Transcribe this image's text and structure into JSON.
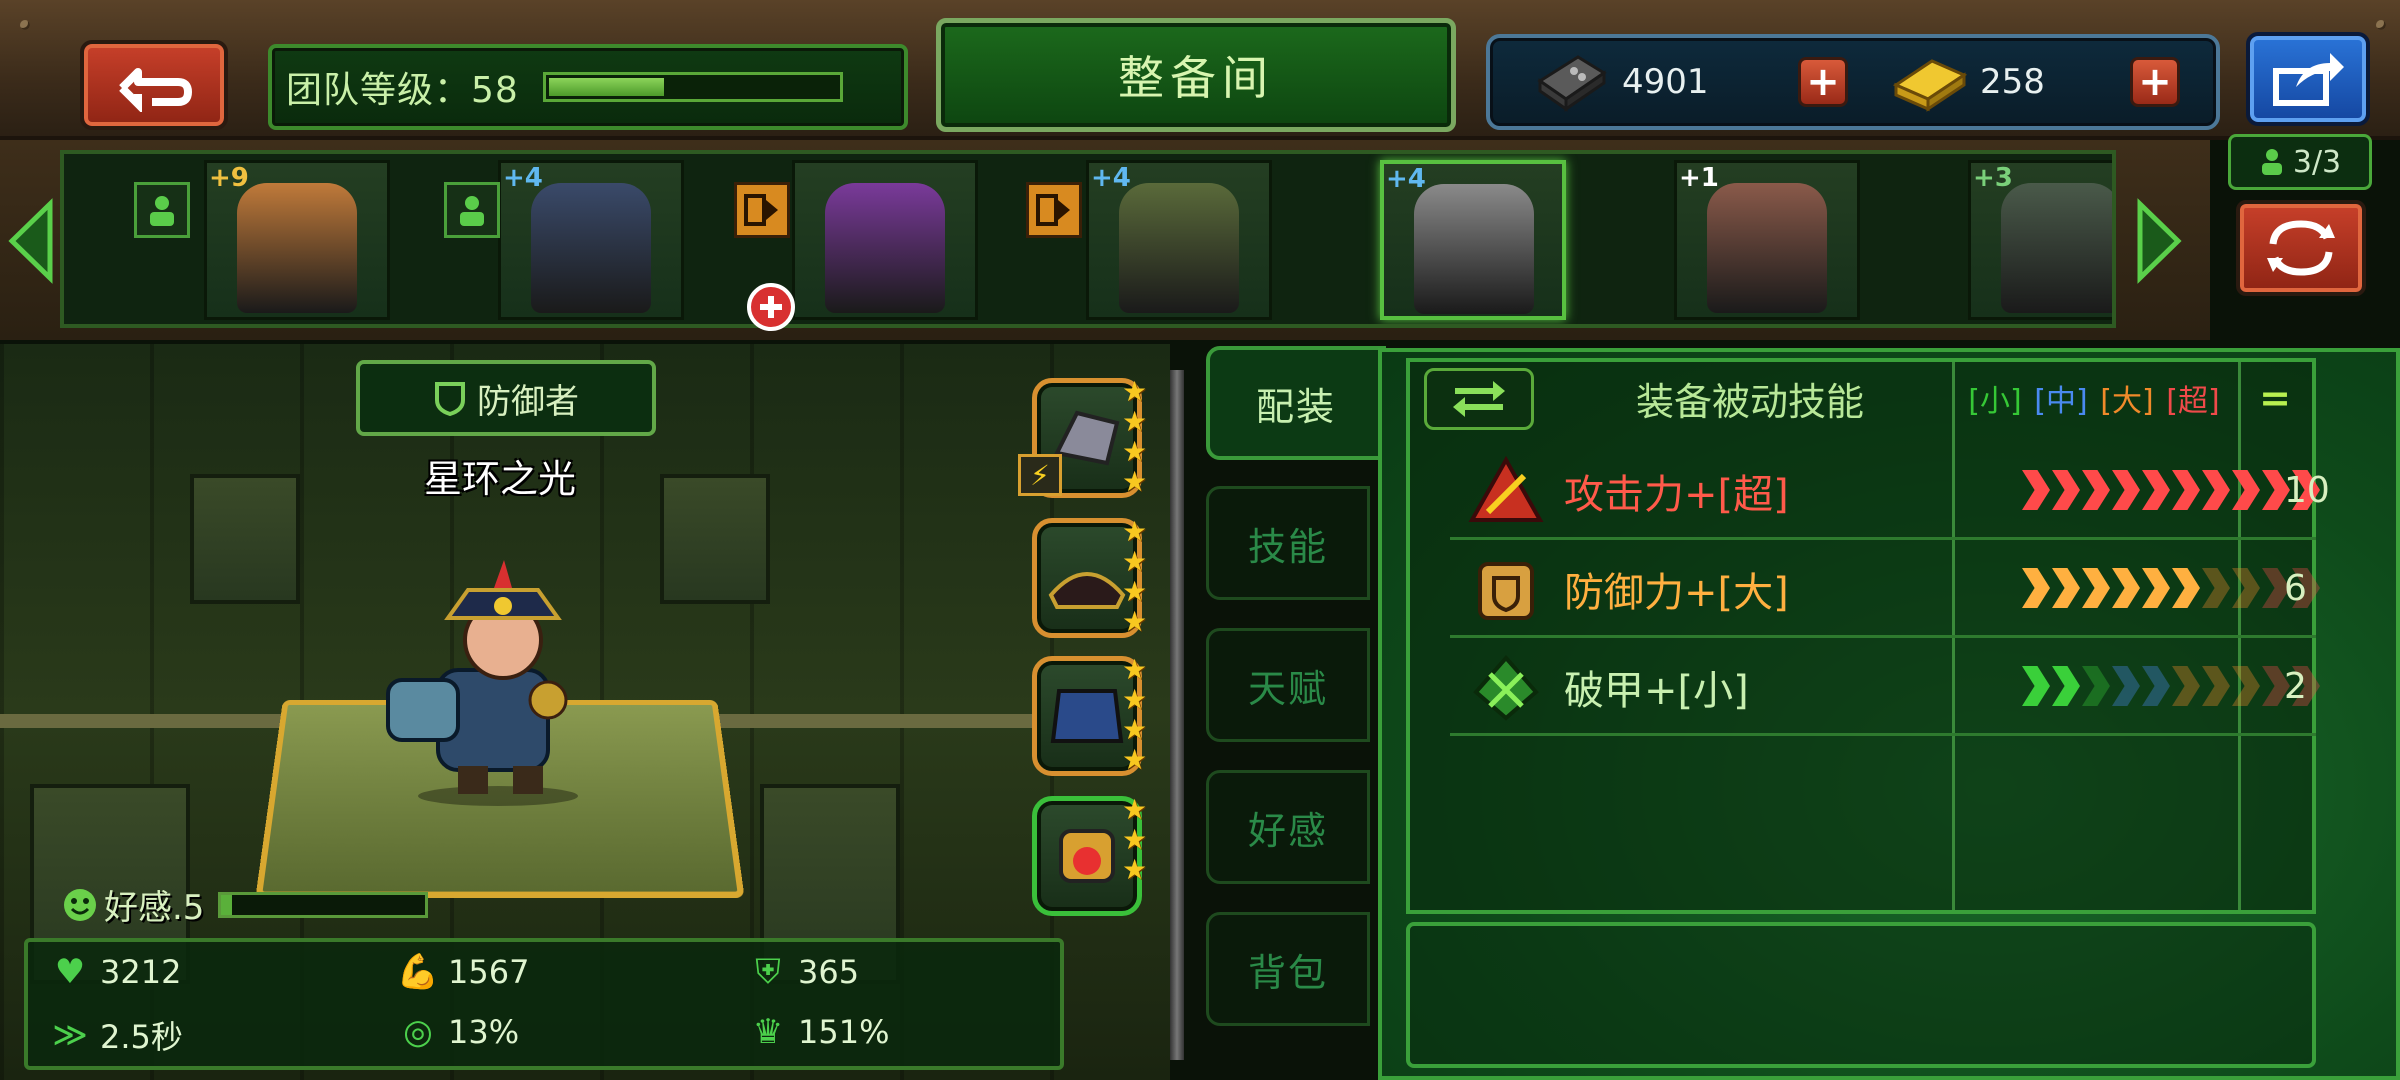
{
  "header": {
    "team_level_label": "团队等级：58",
    "team_level_progress": 0.4,
    "title": "整备间",
    "currencies": [
      {
        "name": "tech-parts",
        "value": "4901"
      },
      {
        "name": "gold-bars",
        "value": "258"
      }
    ]
  },
  "roster": {
    "count": "3/3",
    "heroes": [
      {
        "plus": "+9",
        "color": "#f0c040",
        "art": "#c07a3a"
      },
      {
        "plus": "+4",
        "color": "#60b8f0",
        "art": "#3a4a6a"
      },
      {
        "plus": "",
        "color": "#ffffff",
        "art": "#7a3a9a"
      },
      {
        "plus": "+4",
        "color": "#60b8f0",
        "art": "#5a6a3a"
      },
      {
        "plus": "+4",
        "color": "#60b8f0",
        "art": "#8a8a8a"
      },
      {
        "plus": "+1",
        "color": "#ffffff",
        "art": "#8a5a4a"
      },
      {
        "plus": "+3",
        "color": "#7ad07a",
        "art": "#4a5a4a"
      }
    ]
  },
  "hero": {
    "class_label": "防御者",
    "name": "星环之光",
    "affection_label": "好感.5",
    "affection_level": 0.05
  },
  "stats": {
    "hp": "3212",
    "attack": "1567",
    "defense": "365",
    "attack_speed": "2.5秒",
    "crit": "13%",
    "crit_damage": "151%"
  },
  "tabs": [
    "配装",
    "技能",
    "天赋",
    "好感",
    "背包"
  ],
  "passives": {
    "header": "装备被动技能",
    "tiers": [
      {
        "label": "[小]",
        "color": "#36c836"
      },
      {
        "label": "[中]",
        "color": "#4a8af0"
      },
      {
        "label": "[大]",
        "color": "#f08a2a"
      },
      {
        "label": "[超]",
        "color": "#f04a4a"
      }
    ],
    "equals": "=",
    "rows": [
      {
        "name": "攻击力+[超]",
        "color": "#ff5a4a",
        "filled": 10,
        "fill_color": "#ff4a4a",
        "count": "10"
      },
      {
        "name": "防御力+[大]",
        "color": "#ffb040",
        "filled": 6,
        "fill_color": "#ffb040",
        "count": "6"
      },
      {
        "name": "破甲+[小]",
        "color": "#c8f0b0",
        "filled": 2,
        "fill_color": "#3ad03a",
        "count": "2"
      }
    ]
  },
  "colors": {
    "accent_green": "#3aa03a",
    "accent_red": "#c8402a",
    "accent_blue": "#2a74d8"
  }
}
